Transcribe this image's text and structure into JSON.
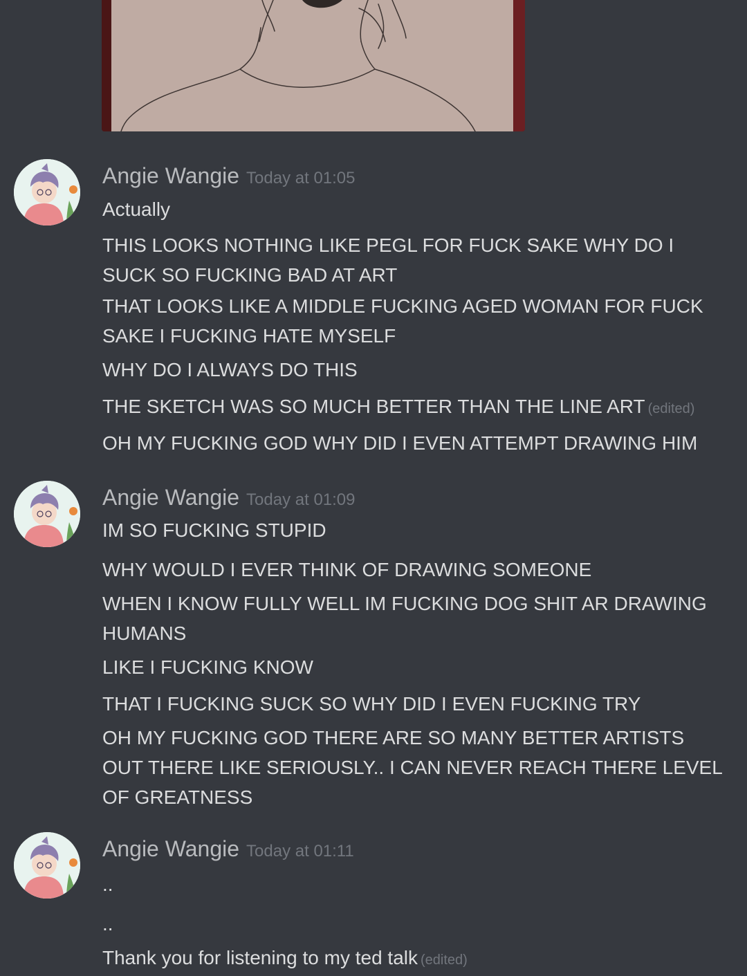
{
  "colors": {
    "background": "#36393f",
    "username": "#b9bbbe",
    "message_text": "#dcddde",
    "muted": "#72767d"
  },
  "attachment": {
    "icon": "sketch-image"
  },
  "groups": [
    {
      "username": "Angie Wangie",
      "timestamp": "Today at 01:05",
      "avatar_icon": "user-avatar",
      "messages": [
        {
          "text": "Actually"
        },
        {
          "text": "THIS LOOKS NOTHING LIKE PEGL FOR FUCK SAKE WHY DO I SUCK SO FUCKING BAD AT ART"
        },
        {
          "text": "THAT LOOKS LIKE A MIDDLE FUCKING AGED WOMAN FOR FUCK SAKE I FUCKING HATE MYSELF"
        },
        {
          "text": "WHY DO I ALWAYS DO THIS"
        },
        {
          "text": "THE SKETCH WAS SO MUCH BETTER THAN THE LINE ART",
          "edited": "(edited)"
        },
        {
          "text": "OH MY FUCKING GOD WHY DID I EVEN ATTEMPT DRAWING HIM"
        }
      ]
    },
    {
      "username": "Angie Wangie",
      "timestamp": "Today at 01:09",
      "avatar_icon": "user-avatar",
      "messages": [
        {
          "text": "IM SO FUCKING STUPID"
        },
        {
          "text": "WHY WOULD I EVER THINK OF DRAWING SOMEONE"
        },
        {
          "text": "WHEN I KNOW FULLY WELL IM FUCKING DOG SHIT AR DRAWING HUMANS"
        },
        {
          "text": "LIKE I FUCKING KNOW"
        },
        {
          "text": "THAT I FUCKING SUCK SO WHY DID I EVEN FUCKING TRY"
        },
        {
          "text": "OH MY FUCKING GOD THERE ARE SO MANY BETTER ARTISTS OUT THERE LIKE SERIOUSLY.. I CAN NEVER REACH THERE LEVEL OF GREATNESS"
        }
      ]
    },
    {
      "username": "Angie Wangie",
      "timestamp": "Today at 01:11",
      "avatar_icon": "user-avatar",
      "messages": [
        {
          "text": ".."
        },
        {
          "text": ".."
        },
        {
          "text": "Thank you for listening to my ted talk",
          "edited": "(edited)"
        }
      ]
    }
  ]
}
